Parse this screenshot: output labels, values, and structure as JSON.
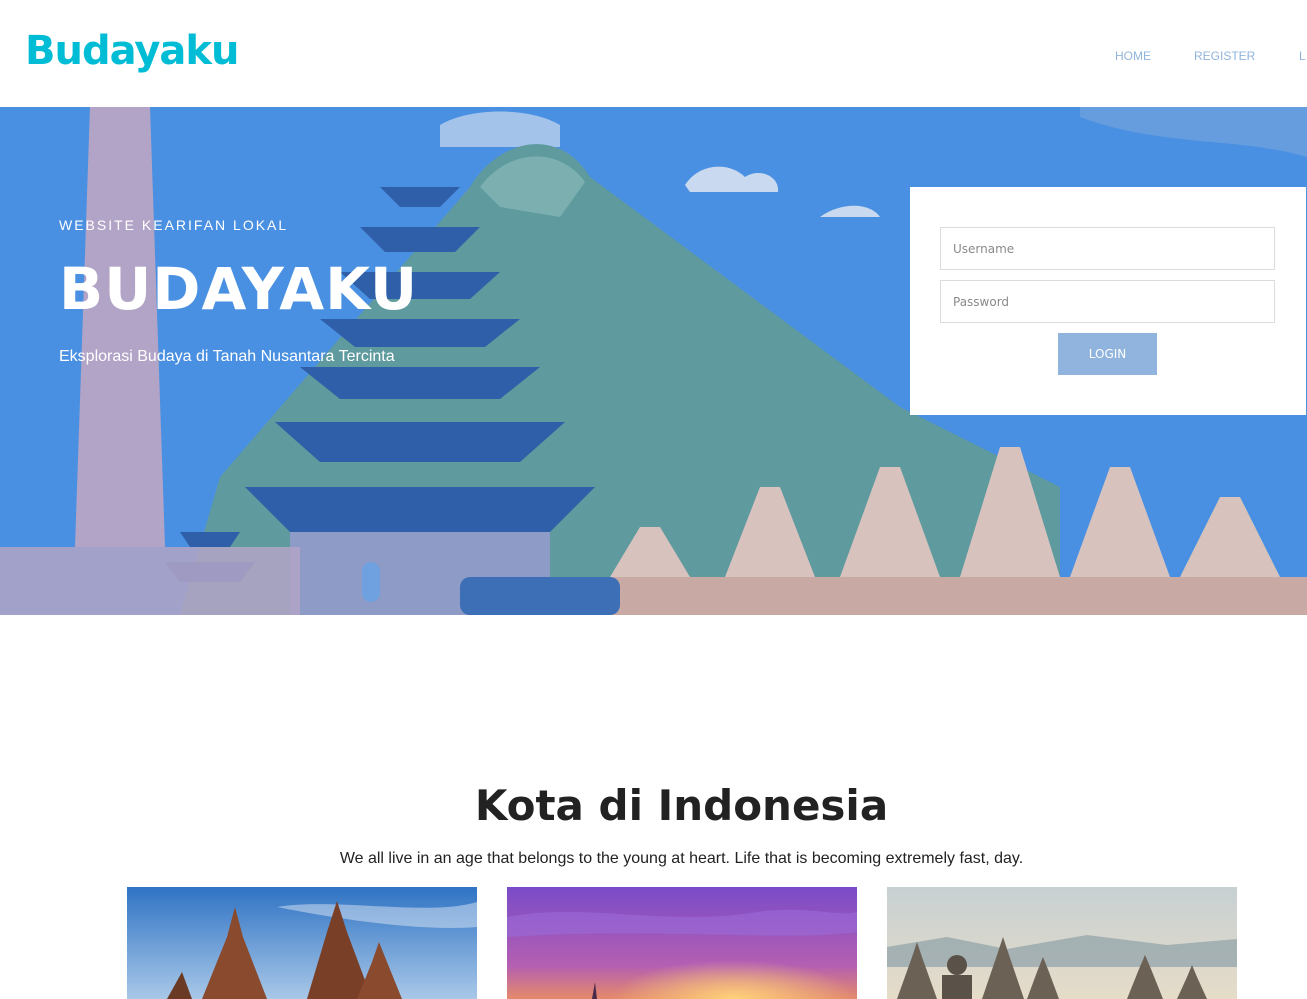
{
  "header": {
    "logo": "Budayaku",
    "nav": [
      {
        "label": "HOME"
      },
      {
        "label": "REGISTER"
      },
      {
        "label": "L"
      }
    ]
  },
  "hero": {
    "kicker": "WEBSITE KEARIFAN LOKAL",
    "title": "BUDAYAKU",
    "subtitle": "Eksplorasi Budaya di Tanah Nusantara Tercinta"
  },
  "login": {
    "username_placeholder": "Username",
    "password_placeholder": "Password",
    "button_label": "LOGIN"
  },
  "section": {
    "title": "Kota di Indonesia",
    "subtitle": "We all live in an age that belongs to the young at heart. Life that is becoming extremely fast, day."
  },
  "colors": {
    "brand": "#00bcd4",
    "nav_link": "#90b4de",
    "button": "#90b4de",
    "hero_sky": "#4a90e2"
  }
}
